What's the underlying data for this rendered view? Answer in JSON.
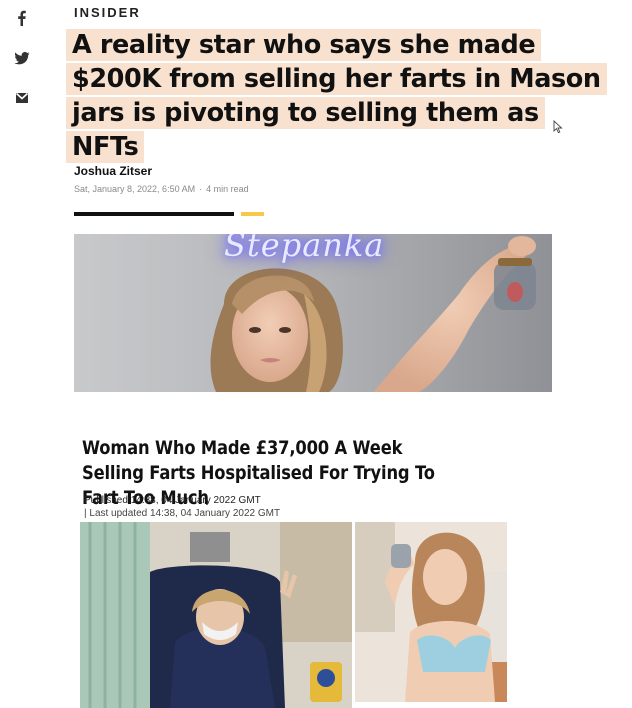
{
  "share": {
    "facebook_icon": "facebook-icon",
    "twitter_icon": "twitter-icon",
    "email_icon": "email-icon"
  },
  "article": {
    "brand": "INSIDER",
    "headline": "A reality star who says she made $200K from selling her farts in Mason jars is pivoting to selling them as NFTs",
    "author": "Joshua Zitser",
    "date": "Sat, January 8, 2022, 6:50 AM",
    "read_time": "4 min read",
    "separator": "·",
    "hero_sign_text": "Stepanka"
  },
  "story2": {
    "title": "Woman Who Made £37,000 A Week Selling Farts Hospitalised For Trying To Fart Too Much",
    "published": "Published 14:38, 04 January 2022 GMT",
    "updated": "| Last updated 14:38, 04 January 2022 GMT"
  },
  "colors": {
    "highlight": "#f8e2cf",
    "progress_dark": "#111111",
    "progress_accent": "#f7c948"
  }
}
